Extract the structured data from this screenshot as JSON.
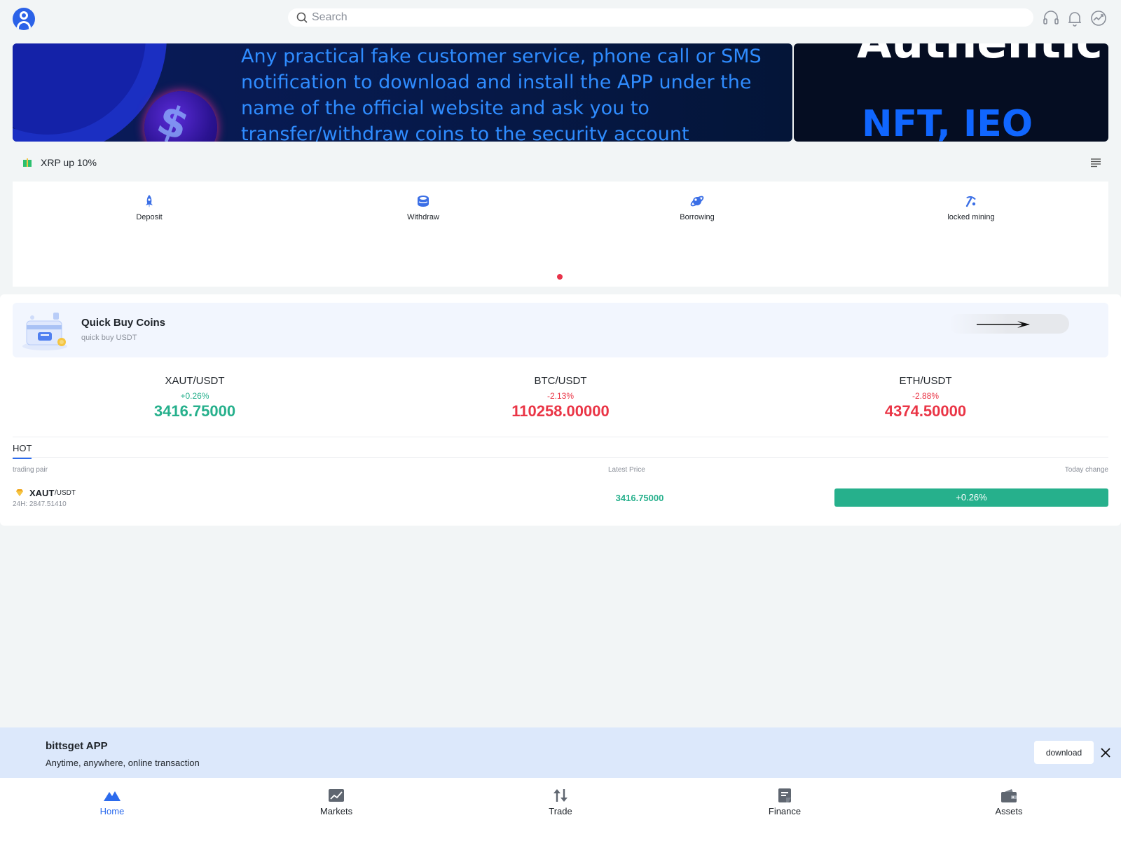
{
  "header": {
    "search_placeholder": "Search",
    "icons": [
      "support-headset-icon",
      "bell-icon",
      "market-chart-icon"
    ]
  },
  "banner": {
    "text": "Any practical fake customer service, phone call or SMS notification to download and install the APP under the name of the official website and ask you to transfer/withdraw coins to the security account",
    "secondary_text": "NFT, IEO",
    "secondary_cut_text": "Authentic"
  },
  "notice": {
    "text": "XRP up 10%"
  },
  "quick_menu": [
    {
      "label": "Deposit",
      "icon": "rocket-icon"
    },
    {
      "label": "Withdraw",
      "icon": "coin-stack-icon"
    },
    {
      "label": "Borrowing",
      "icon": "planet-icon"
    },
    {
      "label": "locked mining",
      "icon": "pickaxe-icon"
    }
  ],
  "quick_buy": {
    "title": "Quick Buy Coins",
    "subtitle": "quick buy USDT"
  },
  "tickers": [
    {
      "pair": "XAUT/USDT",
      "change": "+0.26%",
      "price": "3416.75000",
      "direction": "up"
    },
    {
      "pair": "BTC/USDT",
      "change": "-2.13%",
      "price": "110258.00000",
      "direction": "down"
    },
    {
      "pair": "ETH/USDT",
      "change": "-2.88%",
      "price": "4374.50000",
      "direction": "down"
    }
  ],
  "hot": {
    "tab_label": "HOT",
    "columns": [
      "trading pair",
      "Latest Price",
      "Today change"
    ],
    "rows": [
      {
        "base": "XAUT",
        "quote": "/USDT",
        "volume": "24H: 2847.51410",
        "price": "3416.75000",
        "change": "+0.26%"
      }
    ]
  },
  "app_bar": {
    "title": "bittsget APP",
    "subtitle": "Anytime, anywhere, online transaction",
    "download_label": "download"
  },
  "nav": [
    {
      "label": "Home",
      "icon": "home-mountain-icon",
      "active": true
    },
    {
      "label": "Markets",
      "icon": "markets-chart-icon",
      "active": false
    },
    {
      "label": "Trade",
      "icon": "trade-arrows-icon",
      "active": false
    },
    {
      "label": "Finance",
      "icon": "finance-document-icon",
      "active": false
    },
    {
      "label": "Assets",
      "icon": "wallet-icon",
      "active": false
    }
  ],
  "colors": {
    "accent": "#2c6bed",
    "up": "#26b08c",
    "down": "#ea3546",
    "app_bar_bg": "#dce8fb"
  }
}
